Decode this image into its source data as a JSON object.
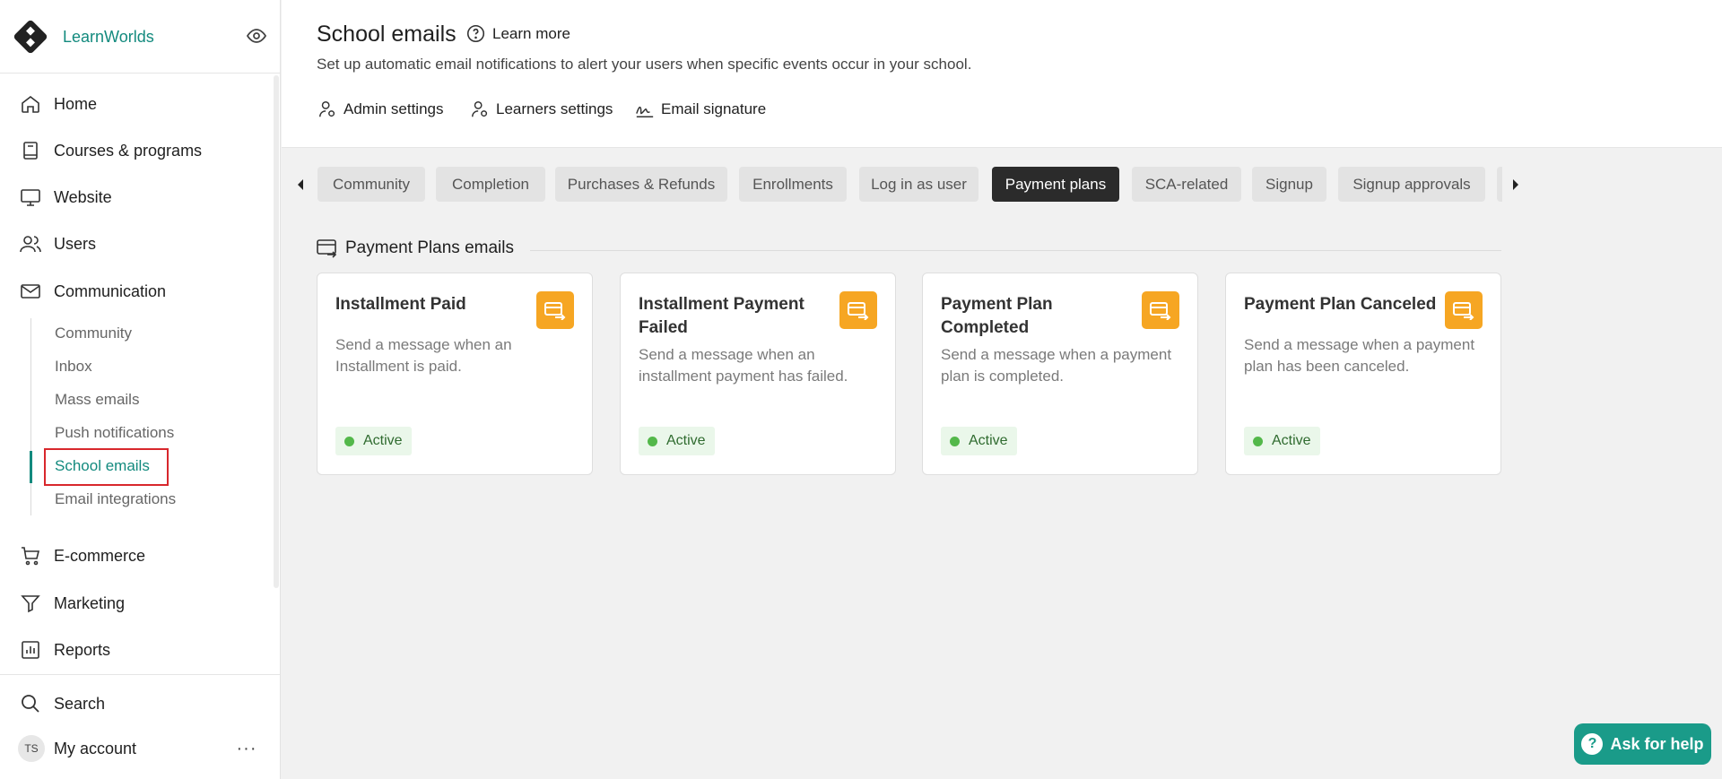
{
  "brand": {
    "name": "LearnWorlds"
  },
  "nav": {
    "home": "Home",
    "courses": "Courses & programs",
    "website": "Website",
    "users": "Users",
    "communication": "Communication",
    "ecommerce": "E-commerce",
    "marketing": "Marketing",
    "reports": "Reports",
    "search": "Search",
    "account": "My account"
  },
  "communication_sub": {
    "community": "Community",
    "inbox": "Inbox",
    "mass_emails": "Mass emails",
    "push_notifications": "Push notifications",
    "school_emails": "School emails",
    "email_integrations": "Email integrations"
  },
  "account": {
    "initials": "TS",
    "more": "···"
  },
  "header": {
    "title": "School emails",
    "learn_more": "Learn more",
    "subtitle": "Set up automatic email notifications to alert your users when specific events occur in your school.",
    "admin_settings": "Admin settings",
    "learners_settings": "Learners settings",
    "email_signature": "Email signature"
  },
  "tabs": [
    {
      "label": "Community"
    },
    {
      "label": "Completion"
    },
    {
      "label": "Purchases & Refunds"
    },
    {
      "label": "Enrollments"
    },
    {
      "label": "Log in as user"
    },
    {
      "label": "Payment plans"
    },
    {
      "label": "SCA-related"
    },
    {
      "label": "Signup"
    },
    {
      "label": "Signup approvals"
    }
  ],
  "active_tab": "Payment plans",
  "section": {
    "title": "Payment Plans emails"
  },
  "cards": [
    {
      "title": "Installment Paid",
      "description": "Send a message when an Installment is paid.",
      "status": "Active"
    },
    {
      "title": "Installment Payment Failed",
      "description": "Send a message when an installment payment has failed.",
      "status": "Active"
    },
    {
      "title": "Payment Plan Completed",
      "description": "Send a message when a payment plan is completed.",
      "status": "Active"
    },
    {
      "title": "Payment Plan Canceled",
      "description": "Send a message when a payment plan has been canceled.",
      "status": "Active"
    }
  ],
  "help": {
    "label": "Ask for help"
  },
  "colors": {
    "brand": "#138a7e",
    "card_icon": "#f6a623",
    "active_tab": "#2b2b2b",
    "status_dot": "#53b84a",
    "help_button": "#1a9b89",
    "highlight": "#d8272c"
  },
  "icons": {
    "brand": "learnworlds-logo-icon",
    "preview": "eye-icon",
    "learn_more": "question-circle-icon",
    "card": "card-transfer-icon"
  }
}
